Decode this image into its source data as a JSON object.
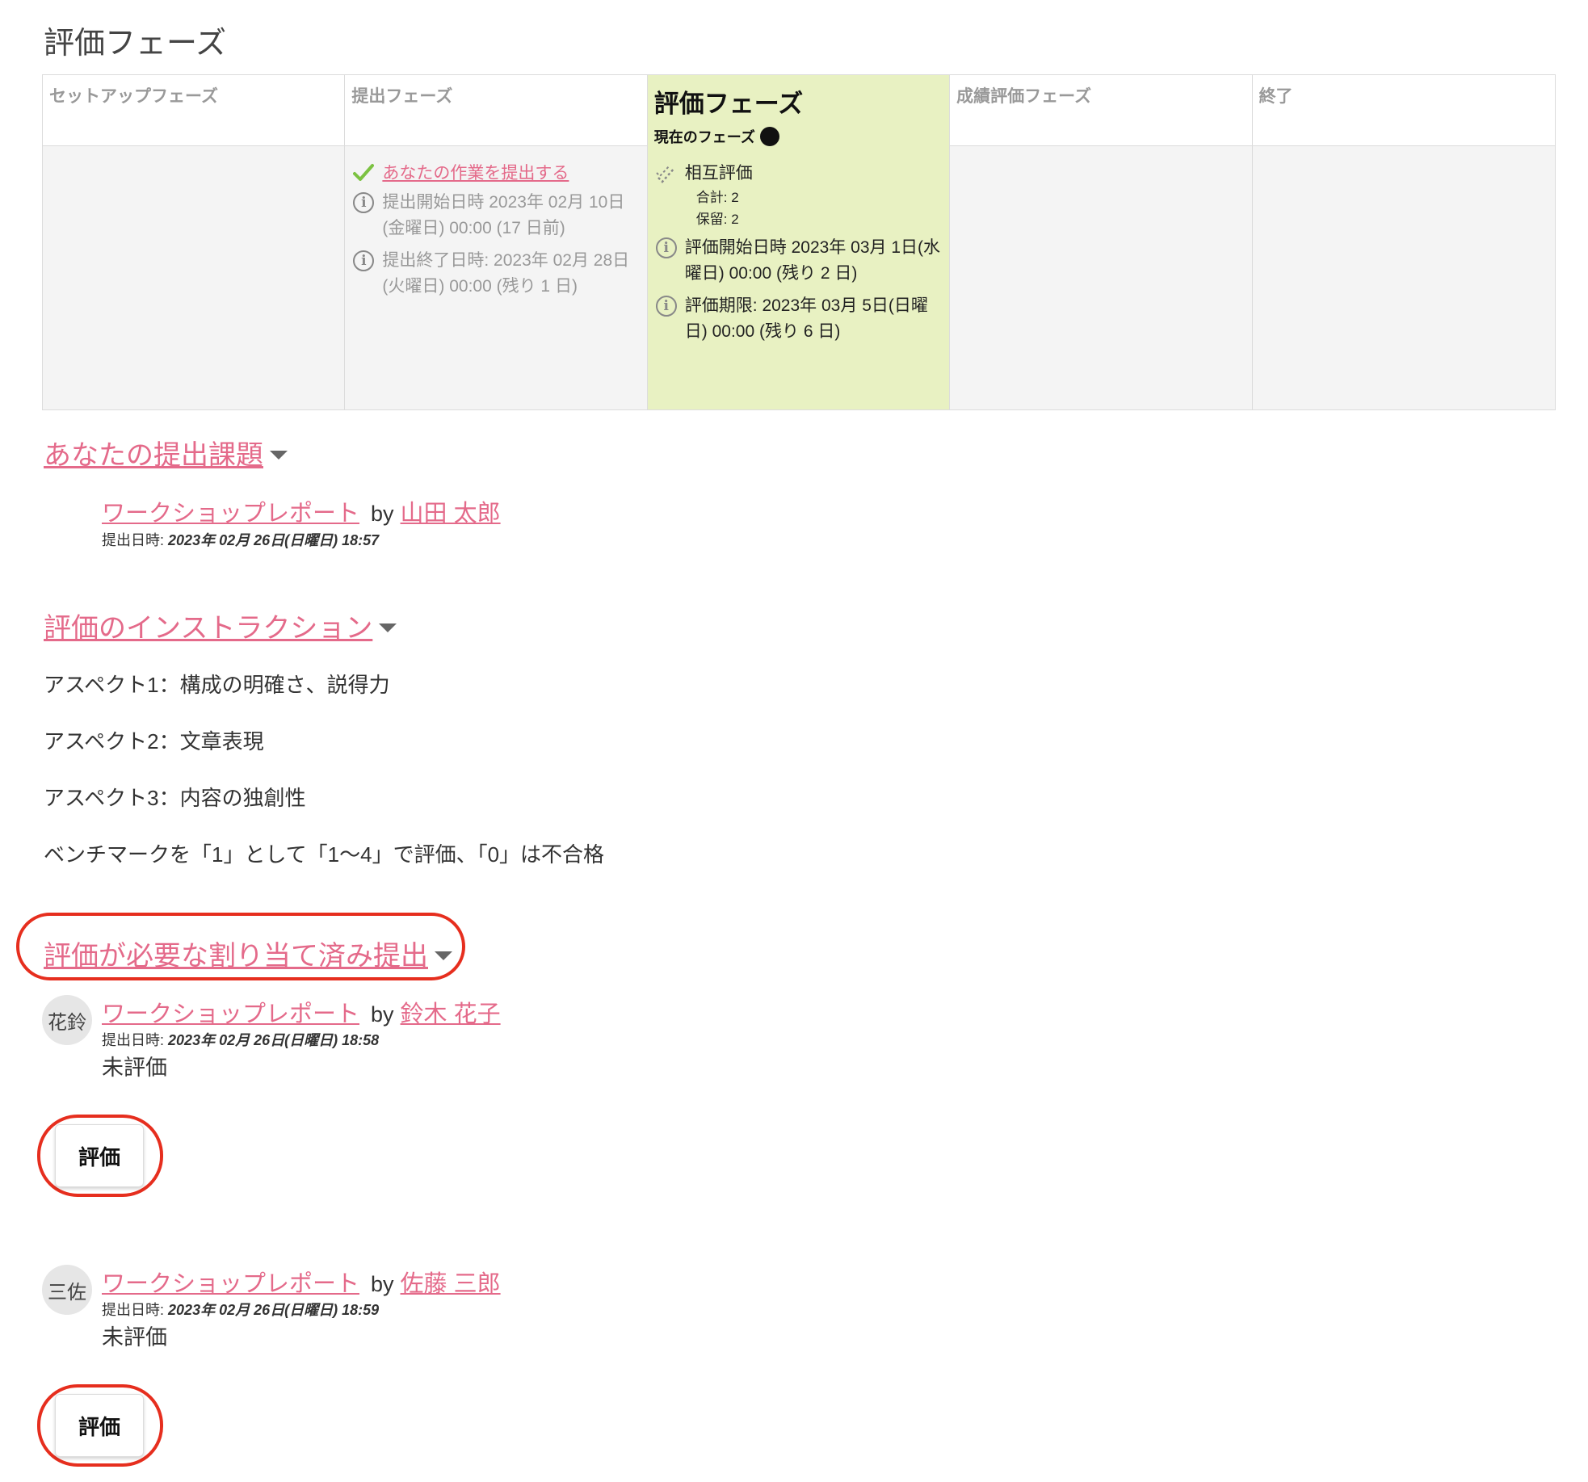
{
  "page": {
    "title": "評価フェーズ"
  },
  "phases": [
    {
      "name": "セットアップフェーズ"
    },
    {
      "name": "提出フェーズ",
      "tasks": {
        "submit_link": "あなたの作業を提出する",
        "start": "提出開始日時 2023年 02月 10日(金曜日) 00:00 (17 日前)",
        "end": "提出終了日時: 2023年 02月 28日(火曜日) 00:00 (残り 1 日)"
      }
    },
    {
      "name": "評価フェーズ",
      "current_label": "現在のフェーズ",
      "tasks": {
        "peer_review": "相互評価",
        "total": "合計: 2",
        "pending": "保留: 2",
        "start": "評価開始日時 2023年 03月 1日(水曜日) 00:00 (残り 2 日)",
        "deadline": "評価期限: 2023年 03月 5日(日曜日) 00:00 (残り 6 日)"
      }
    },
    {
      "name": "成績評価フェーズ"
    },
    {
      "name": "終了"
    }
  ],
  "your_submission": {
    "heading": "あなたの提出課題",
    "title": "ワークショップレポート",
    "by": "by",
    "author": "山田 太郎",
    "meta_label": "提出日時:",
    "meta_value": "2023年 02月 26日(日曜日) 18:57"
  },
  "instructions": {
    "heading": "評価のインストラクション",
    "lines": [
      "アスペクト1：構成の明確さ、説得力",
      "アスペクト2：文章表現",
      "アスペクト3：内容の独創性",
      "ベンチマークを「1」として「1～4」で評価、「0」は不合格"
    ]
  },
  "assigned": {
    "heading": "評価が必要な割り当て済み提出",
    "items": [
      {
        "avatar": "花鈴",
        "title": "ワークショップレポート",
        "by": "by",
        "author": "鈴木 花子",
        "meta_label": "提出日時:",
        "meta_value": "2023年 02月 26日(日曜日) 18:58",
        "status": "未評価",
        "button": "評価"
      },
      {
        "avatar": "三佐",
        "title": "ワークショップレポート",
        "by": "by",
        "author": "佐藤 三郎",
        "meta_label": "提出日時:",
        "meta_value": "2023年 02月 26日(日曜日) 18:59",
        "status": "未評価",
        "button": "評価"
      }
    ]
  },
  "colors": {
    "link": "#e46a8a",
    "active_phase": "#e8f1c2",
    "highlight_ring": "#e62e1e",
    "check": "#7cc242"
  },
  "icons": [
    "check-icon",
    "info-icon",
    "peer-review-icon",
    "caret-down-icon"
  ]
}
